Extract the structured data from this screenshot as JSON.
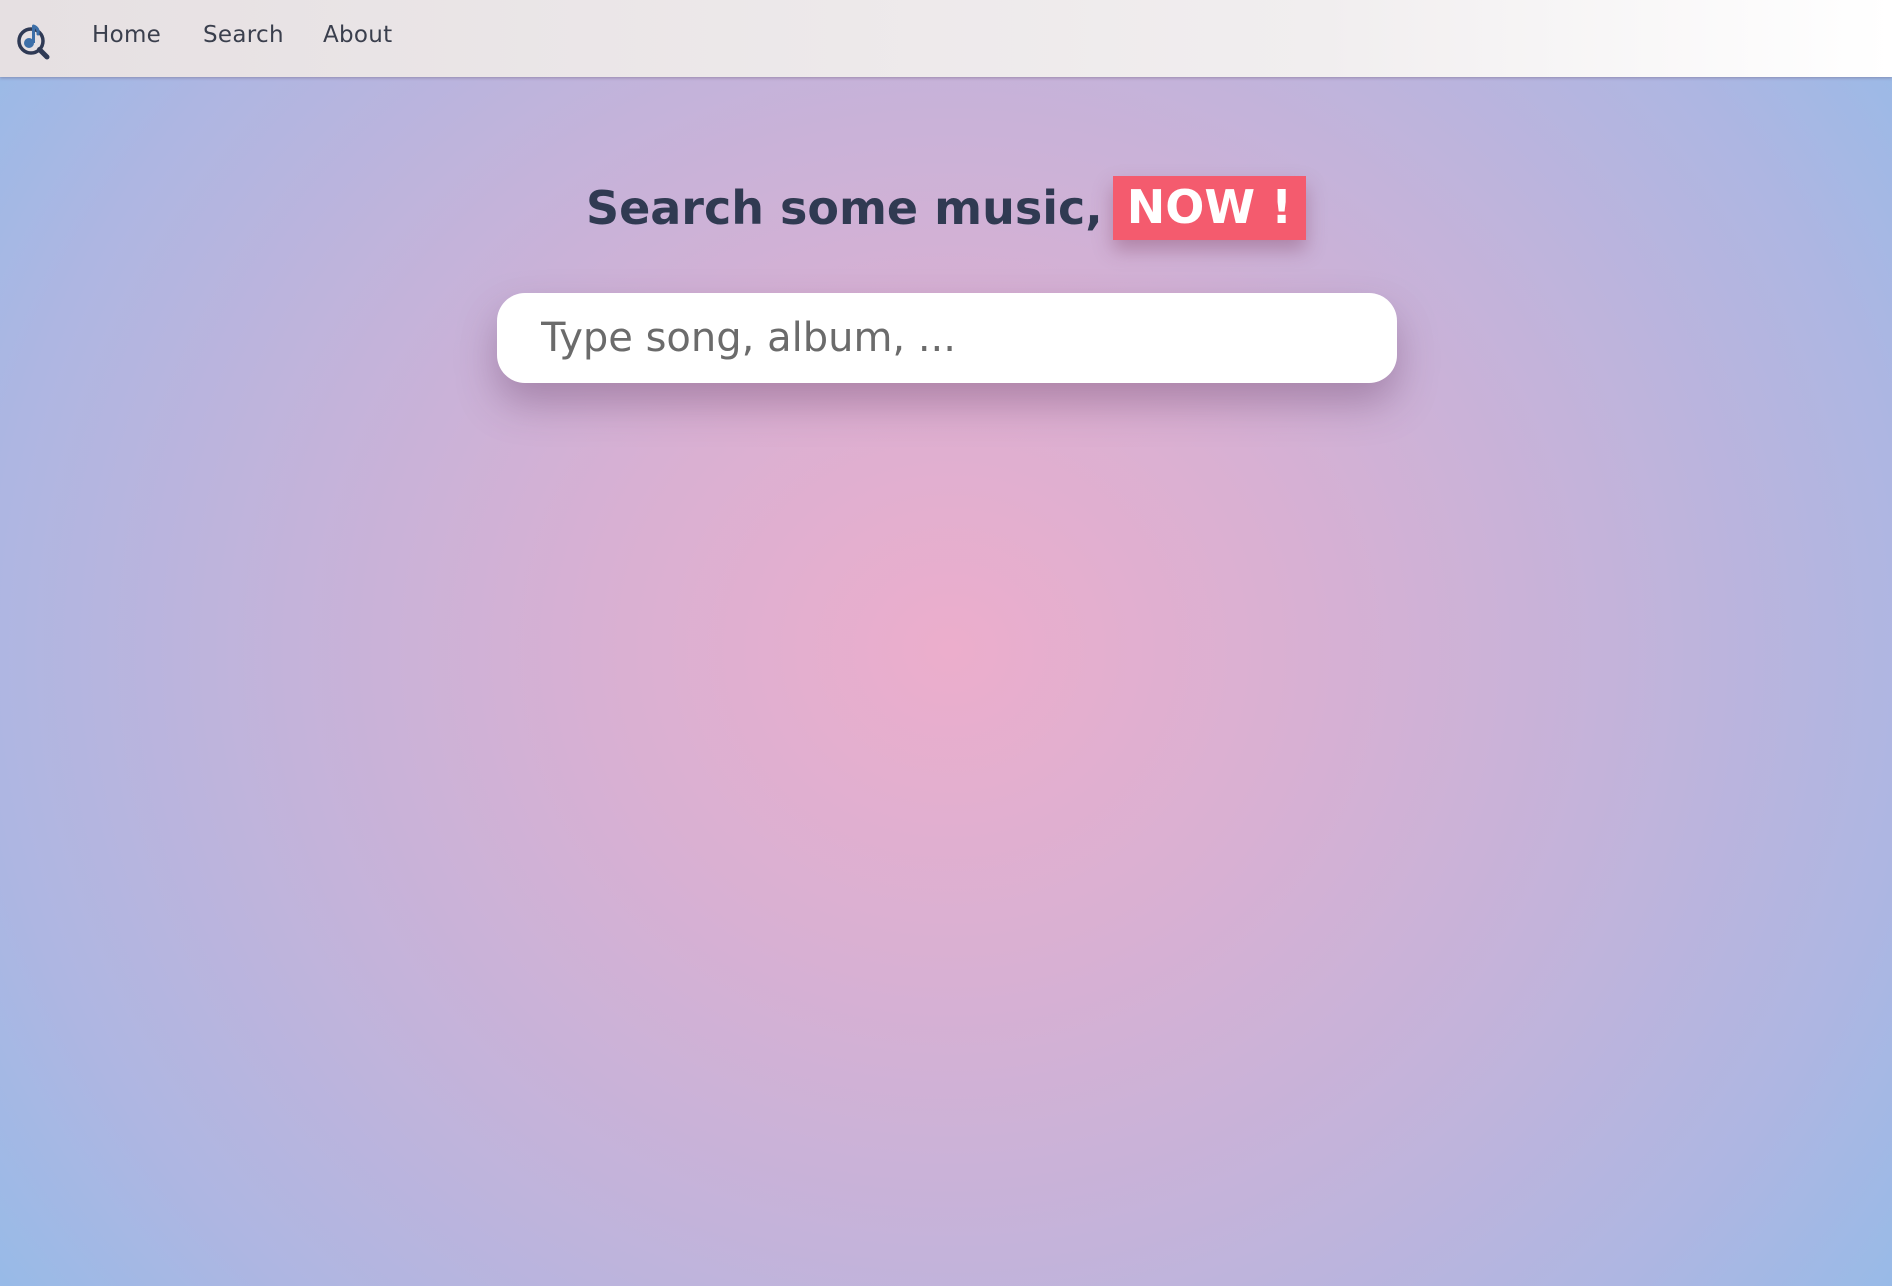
{
  "nav": {
    "logo_icon": "music-search-logo-icon",
    "items": [
      {
        "label": "Home"
      },
      {
        "label": "Search"
      },
      {
        "label": "About"
      }
    ]
  },
  "hero": {
    "headline": "Search some music,",
    "badge": "NOW !"
  },
  "search": {
    "placeholder": "Type song, album, ...",
    "value": ""
  },
  "colors": {
    "accent": "#f45b6e",
    "headline": "#303a52",
    "logo": "#3d6fa8"
  }
}
